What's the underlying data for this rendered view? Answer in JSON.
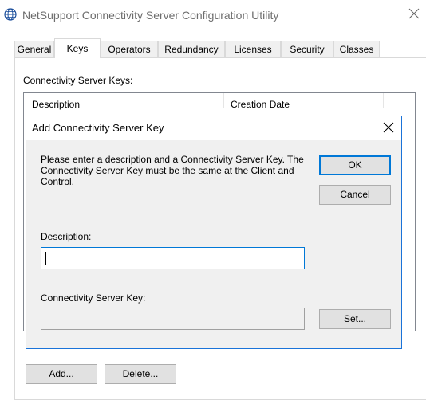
{
  "window": {
    "title": "NetSupport Connectivity Server Configuration Utility",
    "icon": "globe-icon",
    "close_icon": "close-icon"
  },
  "tabs": [
    {
      "label": "General",
      "active": false
    },
    {
      "label": "Keys",
      "active": true
    },
    {
      "label": "Operators",
      "active": false
    },
    {
      "label": "Redundancy",
      "active": false
    },
    {
      "label": "Licenses",
      "active": false
    },
    {
      "label": "Security",
      "active": false
    },
    {
      "label": "Classes",
      "active": false
    }
  ],
  "keys_page": {
    "section_label": "Connectivity Server Keys:",
    "columns": [
      "Description",
      "Creation Date"
    ],
    "add_label": "Add...",
    "delete_label": "Delete..."
  },
  "dialog": {
    "title": "Add Connectivity Server Key",
    "instructions": "Please enter a description and a Connectivity Server Key. The Connectivity Server Key must be the same at the Client and Control.",
    "ok_label": "OK",
    "cancel_label": "Cancel",
    "description_label": "Description:",
    "description_value": "",
    "key_label": "Connectivity Server Key:",
    "key_value": "",
    "set_label": "Set..."
  },
  "colors": {
    "accent": "#0078d7",
    "dialog_border": "#1a73d9",
    "dialog_bg": "#f0f0f0",
    "title_text": "#6d6d6d"
  }
}
